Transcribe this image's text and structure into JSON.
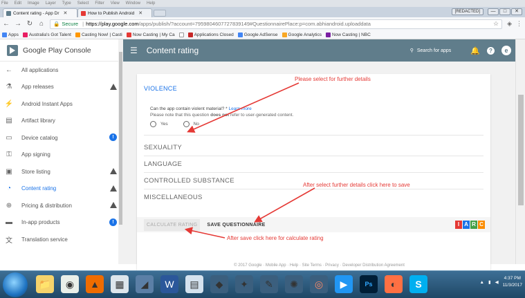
{
  "window": {
    "menu": [
      "File",
      "Edit",
      "Image",
      "Layer",
      "Type",
      "Select",
      "Filter",
      "View",
      "Window",
      "Help"
    ],
    "ctrl_min": "—",
    "ctrl_max": "□",
    "ctrl_close": "✕"
  },
  "tabs": [
    {
      "label": "Content rating - App Dr",
      "close": "✕"
    },
    {
      "label": "How to Publish Android",
      "close": "✕"
    }
  ],
  "profile_chip": "[REDACTED]",
  "address": {
    "secure_label": "Secure",
    "host": "https://play.google.com",
    "path": "/apps/publish/?account=7959804607727839149#QuestionnairePlace:p=com.abhiandroid.uploaddata"
  },
  "bookmarks": [
    {
      "label": "Apps",
      "color": "#4285f4"
    },
    {
      "label": "Australia's Got Talent",
      "color": "#e91e63"
    },
    {
      "label": "Casting Now! | Casti",
      "color": "#ff9800"
    },
    {
      "label": "Now Casting | My Ca",
      "color": "#e53935"
    },
    {
      "label": "",
      "color": "#bbbbbb"
    },
    {
      "label": "Applications Closed",
      "color": "#c62828"
    },
    {
      "label": "Google AdSense",
      "color": "#4285f4"
    },
    {
      "label": "Google Analytics",
      "color": "#f9a825"
    },
    {
      "label": "Now Casting | NBC",
      "color": "#7b1fa2"
    }
  ],
  "sidebar": {
    "title": "Google Play Console",
    "items": [
      {
        "label": "All applications",
        "icon": "←"
      },
      {
        "label": "App releases",
        "icon": "⚗"
      },
      {
        "label": "Android Instant Apps",
        "icon": "⚡"
      },
      {
        "label": "Artifact library",
        "icon": "▤"
      },
      {
        "label": "Device catalog",
        "icon": "▭"
      },
      {
        "label": "App signing",
        "icon": "⚿"
      },
      {
        "label": "Store listing",
        "icon": "▣"
      },
      {
        "label": "Content rating",
        "icon": "◔"
      },
      {
        "label": "Pricing & distribution",
        "icon": "⊕"
      },
      {
        "label": "In-app products",
        "icon": "▬"
      },
      {
        "label": "Translation service",
        "icon": "文"
      }
    ],
    "badge_count": "!"
  },
  "header": {
    "title": "Content rating",
    "search_placeholder": "Search for apps",
    "account_initial": "e"
  },
  "questionnaire": {
    "violence": "VIOLENCE",
    "question": "Can the app contain violent material? *",
    "learn_more": "Learn more",
    "note_pre": "Please note that this question ",
    "note_bold": "does not",
    "note_post": " refer to user-generated content.",
    "yes": "Yes",
    "no": "No",
    "sections": [
      "SEXUALITY",
      "LANGUAGE",
      "CONTROLLED SUBSTANCE",
      "MISCELLANEOUS"
    ],
    "calculate": "CALCULATE RATING",
    "save": "SAVE QUESTIONNAIRE",
    "iarc": [
      "I",
      "A",
      "R",
      "C"
    ]
  },
  "annotations": {
    "select": "Please select for further details",
    "save": "After select further details click here to save",
    "calc": "After save click here for calculate rating"
  },
  "footer": "© 2017 Google · Mobile App · Help · Site Terms · Privacy · Developer Distribution Agreement",
  "taskbar": {
    "time": "4:37 PM",
    "date": "11/3/2017"
  }
}
